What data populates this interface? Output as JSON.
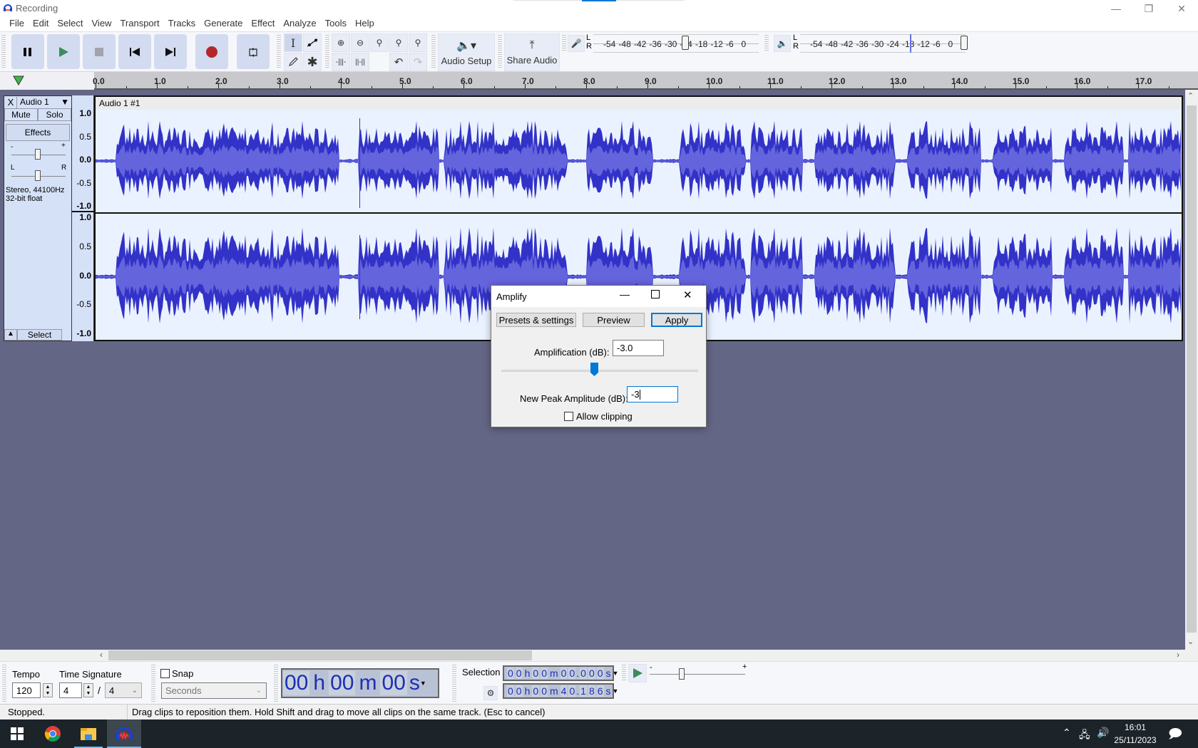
{
  "window": {
    "title": "Recording",
    "controls": [
      "minimize",
      "restore",
      "close"
    ]
  },
  "menu": [
    "File",
    "Edit",
    "Select",
    "View",
    "Transport",
    "Tracks",
    "Generate",
    "Effect",
    "Analyze",
    "Tools",
    "Help"
  ],
  "transport": {
    "buttons": [
      "pause",
      "play",
      "stop",
      "skip-to-start",
      "skip-to-end",
      "record",
      "loop"
    ]
  },
  "tools": {
    "edit_tools": [
      "selection-tool",
      "envelope-tool",
      "draw-tool",
      "multi-tool"
    ],
    "edit_buttons": [
      "zoom-in",
      "zoom-out",
      "fit-selection",
      "fit-project",
      "zoom-toggle",
      "trim-outside",
      "silence-selection",
      "undo",
      "redo"
    ],
    "audio_setup_label": "Audio Setup",
    "share_audio_label": "Share Audio"
  },
  "meters": {
    "record": {
      "channels": [
        "L",
        "R"
      ],
      "ticks": [
        "-54",
        "-48",
        "-42",
        "-36",
        "-30",
        "-24",
        "-18",
        "-12",
        "-6",
        "0"
      ],
      "level_db": -27
    },
    "playback": {
      "channels": [
        "L",
        "R"
      ],
      "ticks": [
        "-54",
        "-48",
        "-42",
        "-36",
        "-30",
        "-24",
        "-18",
        "-12",
        "-6",
        "0"
      ],
      "level_db": -18
    }
  },
  "timeline": {
    "ticks": [
      "0.0",
      "1.0",
      "2.0",
      "3.0",
      "4.0",
      "5.0",
      "6.0",
      "7.0",
      "8.0",
      "9.0",
      "10.0",
      "11.0",
      "12.0",
      "13.0",
      "14.0",
      "15.0",
      "16.0",
      "17.0"
    ]
  },
  "track": {
    "name": "Audio 1",
    "close_label": "X",
    "mute_label": "Mute",
    "solo_label": "Solo",
    "effects_label": "Effects",
    "gain_minus": "-",
    "gain_plus": "+",
    "pan_left": "L",
    "pan_right": "R",
    "info_line1": "Stereo, 44100Hz",
    "info_line2": "32-bit float",
    "select_label": "Select",
    "clip_name": "Audio 1 #1",
    "amplitude_scale": [
      "1.0",
      "0.5",
      "0.0",
      "-0.5",
      "-1.0"
    ]
  },
  "amplify_dialog": {
    "title": "Amplify",
    "presets_label": "Presets & settings",
    "preview_label": "Preview",
    "apply_label": "Apply",
    "amplification_label": "Amplification (dB):",
    "amplification_value": "-3.0",
    "slider_fraction": 0.47,
    "new_peak_label": "New Peak Amplitude (dB):",
    "new_peak_value": "-3",
    "allow_clipping_label": "Allow clipping",
    "allow_clipping_checked": false
  },
  "bottom": {
    "tempo_label": "Tempo",
    "tempo_value": "120",
    "time_signature_label": "Time Signature",
    "time_sig_num": "4",
    "time_sig_sep": "/",
    "time_sig_den": "4",
    "snap_label": "Snap",
    "snap_unit": "Seconds",
    "time_display": {
      "h": "00",
      "m": "00",
      "s": "00"
    },
    "selection_label": "Selection",
    "selection_start": [
      "0",
      "0",
      "h",
      "0",
      "0",
      "m",
      "0",
      "0",
      ".",
      "0",
      "0",
      "0",
      "s"
    ],
    "selection_end": [
      "0",
      "0",
      "h",
      "0",
      "0",
      "m",
      "4",
      "0",
      ".",
      "1",
      "8",
      "6",
      "s"
    ],
    "play_speed_minus": "-",
    "play_speed_plus": "+"
  },
  "status": {
    "state": "Stopped.",
    "hint": "Drag clips to reposition them. Hold Shift and drag to move all clips on the same track. (Esc to cancel)"
  },
  "taskbar": {
    "apps": [
      "windows-start",
      "chrome",
      "file-explorer",
      "audacity"
    ],
    "time": "16:01",
    "date": "25/11/2023"
  },
  "colors": {
    "waveform": "#3232c8",
    "waveform_rms": "#6464dc",
    "clip_bg": "#eaf2ff",
    "workspace": "#646686",
    "accent": "#0078d7"
  }
}
